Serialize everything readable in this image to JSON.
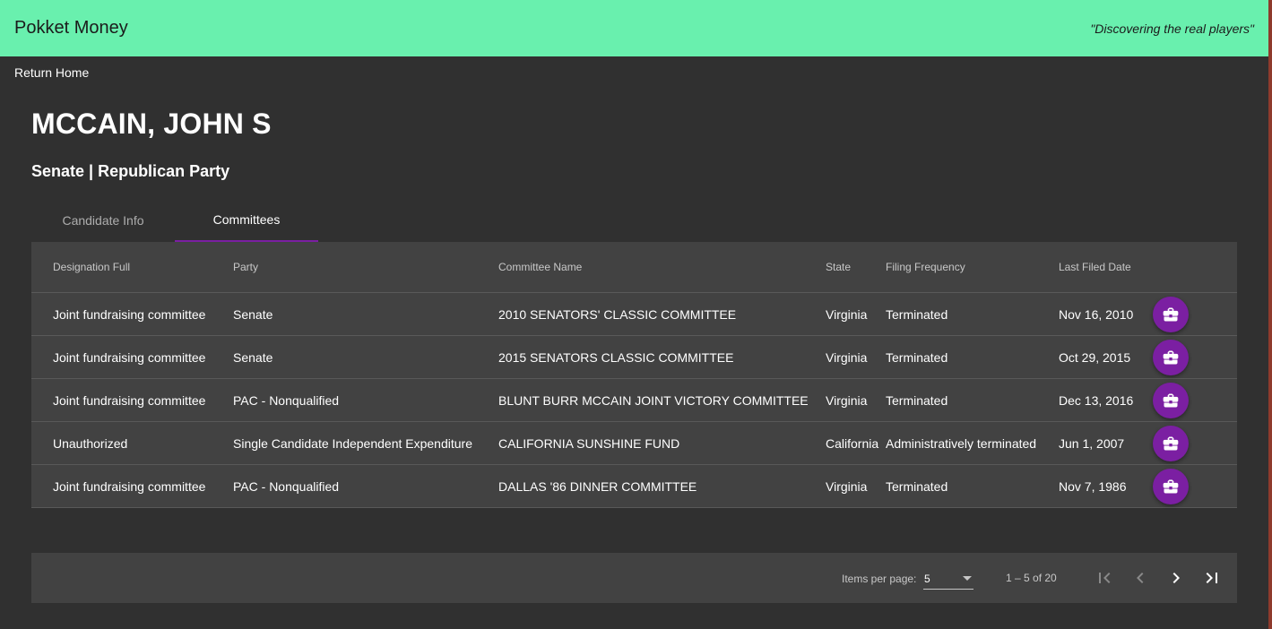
{
  "header": {
    "title": "Pokket Money",
    "tagline": "\"Discovering the real players\""
  },
  "nav": {
    "return_home": "Return Home"
  },
  "candidate": {
    "name": "MCCAIN, JOHN S",
    "subtitle": "Senate | Republican Party"
  },
  "tabs": [
    {
      "label": "Candidate Info",
      "active": false
    },
    {
      "label": "Committees",
      "active": true
    }
  ],
  "table": {
    "columns": [
      "Designation Full",
      "Party",
      "Committee Name",
      "State",
      "Filing Frequency",
      "Last Filed Date"
    ],
    "rows": [
      [
        "Joint fundraising committee",
        "Senate",
        "2010 SENATORS' CLASSIC COMMITTEE",
        "Virginia",
        "Terminated",
        "Nov 16, 2010"
      ],
      [
        "Joint fundraising committee",
        "Senate",
        "2015 SENATORS CLASSIC COMMITTEE",
        "Virginia",
        "Terminated",
        "Oct 29, 2015"
      ],
      [
        "Joint fundraising committee",
        "PAC - Nonqualified",
        "BLUNT BURR MCCAIN JOINT VICTORY COMMITTEE",
        "Virginia",
        "Terminated",
        "Dec 13, 2016"
      ],
      [
        "Unauthorized",
        "Single Candidate Independent Expenditure",
        "CALIFORNIA SUNSHINE FUND",
        "California",
        "Administratively terminated",
        "Jun 1, 2007"
      ],
      [
        "Joint fundraising committee",
        "PAC - Nonqualified",
        "DALLAS '86 DINNER COMMITTEE",
        "Virginia",
        "Terminated",
        "Nov 7, 1986"
      ]
    ],
    "row_action_icon": "briefcase-icon"
  },
  "paginator": {
    "items_per_page_label": "Items per page:",
    "page_size": "5",
    "range_label": "1 – 5 of 20",
    "icons": [
      "first-page-icon",
      "previous-page-icon",
      "next-page-icon",
      "last-page-icon"
    ]
  },
  "colors": {
    "toolbar": "#69f0ae",
    "background": "#303030",
    "surface": "#424242",
    "accent": "#7b1fa2"
  }
}
